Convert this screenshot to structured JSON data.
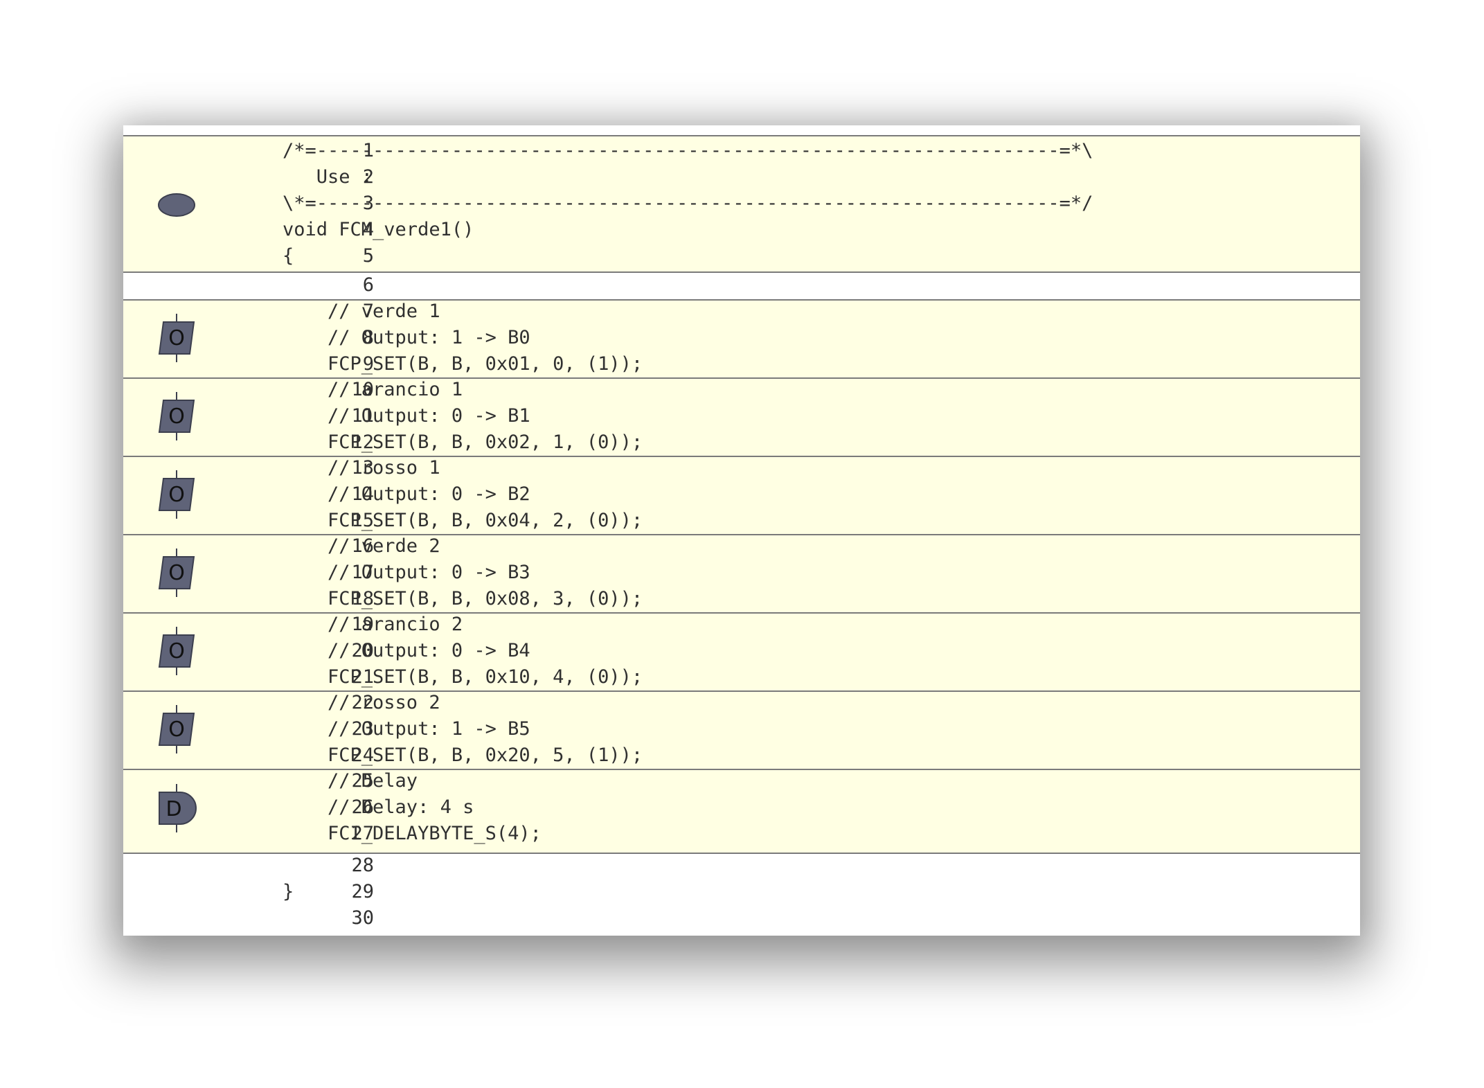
{
  "editor": {
    "lines": [
      {
        "num": "1",
        "text": "/*=------------------------------------------------------------------=*\\"
      },
      {
        "num": "2",
        "text": "   Use :"
      },
      {
        "num": "3",
        "text": "\\*=------------------------------------------------------------------=*/"
      },
      {
        "num": "4",
        "text": "void FCM_verde1()"
      },
      {
        "num": "5",
        "text": "{"
      },
      {
        "num": "6",
        "text": ""
      },
      {
        "num": "7",
        "text": "    // verde 1"
      },
      {
        "num": "8",
        "text": "    // Output: 1 -> B0"
      },
      {
        "num": "9",
        "text": "    FCP_SET(B, B, 0x01, 0, (1));"
      },
      {
        "num": "10",
        "text": "    // arancio 1"
      },
      {
        "num": "11",
        "text": "    // Output: 0 -> B1"
      },
      {
        "num": "12",
        "text": "    FCP_SET(B, B, 0x02, 1, (0));"
      },
      {
        "num": "13",
        "text": "    // rosso 1"
      },
      {
        "num": "14",
        "text": "    // Output: 0 -> B2"
      },
      {
        "num": "15",
        "text": "    FCP_SET(B, B, 0x04, 2, (0));"
      },
      {
        "num": "16",
        "text": "    // verde 2"
      },
      {
        "num": "17",
        "text": "    // Output: 0 -> B3"
      },
      {
        "num": "18",
        "text": "    FCP_SET(B, B, 0x08, 3, (0));"
      },
      {
        "num": "19",
        "text": "    // arancio 2"
      },
      {
        "num": "20",
        "text": "    // Output: 0 -> B4"
      },
      {
        "num": "21",
        "text": "    FCP_SET(B, B, 0x10, 4, (0));"
      },
      {
        "num": "22",
        "text": "    // rosso 2"
      },
      {
        "num": "23",
        "text": "    // Output: 1 -> B5"
      },
      {
        "num": "24",
        "text": "    FCP_SET(B, B, 0x20, 5, (1));"
      },
      {
        "num": "25",
        "text": "    // Delay"
      },
      {
        "num": "26",
        "text": "    // Delay: 4 s"
      },
      {
        "num": "27",
        "text": "    FCI_DELAYBYTE_S(4);"
      },
      {
        "num": "28",
        "text": ""
      },
      {
        "num": "29",
        "text": "}"
      },
      {
        "num": "30",
        "text": ""
      }
    ],
    "icons": {
      "begin": "flowchart-begin-icon",
      "output": "flowchart-output-icon",
      "output_letter": "O",
      "delay": "flowchart-delay-icon",
      "delay_letter": "D"
    },
    "colors": {
      "highlight": "#ffffe3",
      "icon_fill": "#5f6378",
      "separator": "#7a7a7a"
    }
  }
}
